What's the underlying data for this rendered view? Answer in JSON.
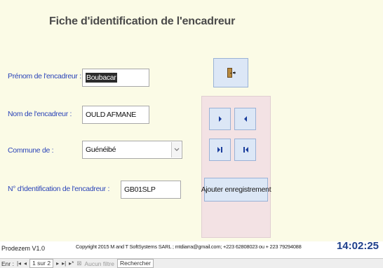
{
  "form": {
    "title": "Fiche d'identification de l'encadreur",
    "fields": {
      "prenom": {
        "label": "Prénom de l'encadreur :",
        "value": "Boubacar"
      },
      "nom": {
        "label": "Nom de l'encadreur :",
        "value": "OULD AFMANE"
      },
      "commune": {
        "label": "Commune de :",
        "value": "Guénéibé"
      },
      "identification": {
        "label": "N° d'identification de l'encadreur :",
        "value": "GB01SLP"
      }
    },
    "buttons": {
      "exit_icon": "door-exit-icon",
      "add_record": "Ajouter enregistrement"
    }
  },
  "footer": {
    "app_name": "Prodezem V1.0",
    "copyright": "Copyright 2015  M and T SoftSystems SARL ; mtdiarra@gmail.com; +223 62808023 ou + 223 79294088",
    "clock": "14:02:25"
  },
  "navbar": {
    "record_label": "Enr :",
    "position": "1 sur 2",
    "filter": "Aucun filtre",
    "search": "Rechercher"
  },
  "colors": {
    "form_bg": "#fbfbe6",
    "label": "#2b44b8",
    "panel_bg": "#f3e2e4",
    "button_bg": "#dce7f6",
    "clock": "#1e3f8a"
  }
}
